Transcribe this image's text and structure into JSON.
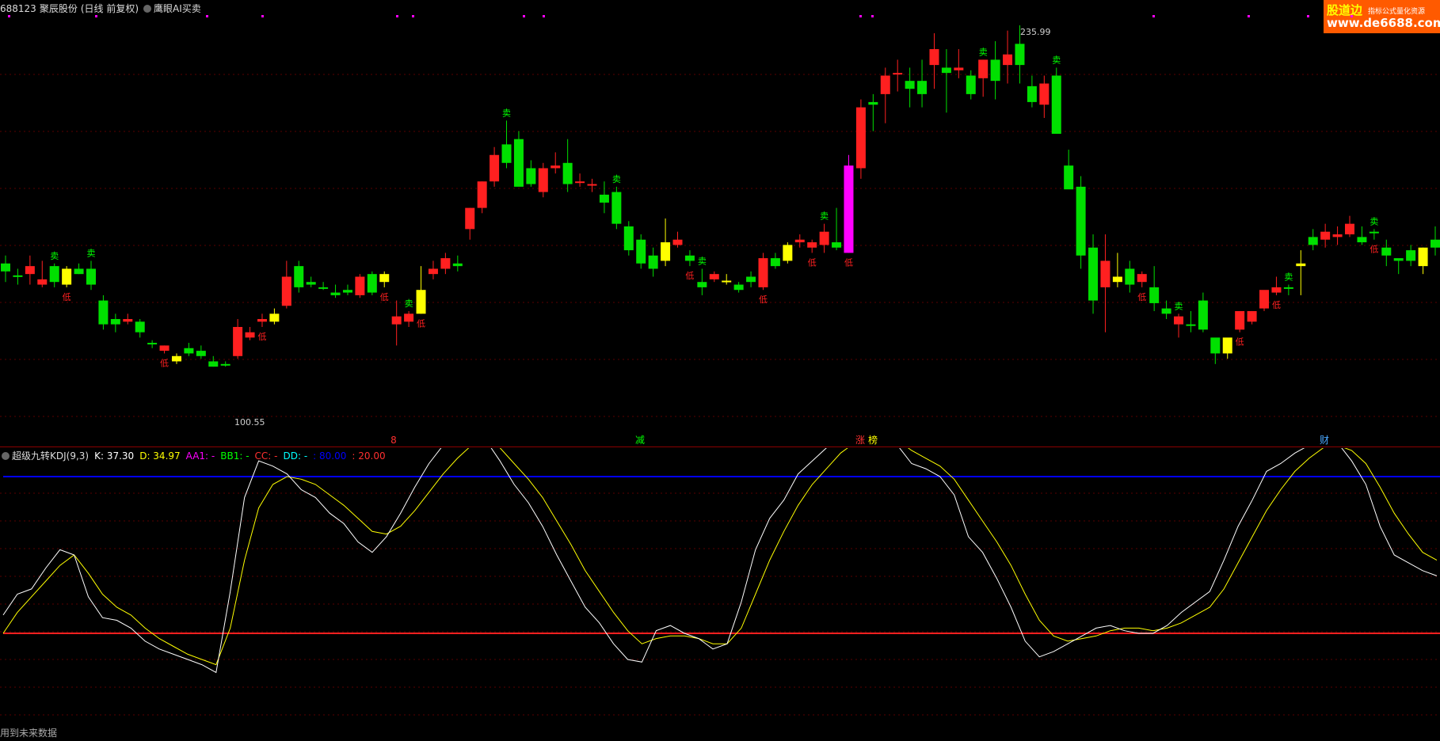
{
  "header": {
    "code": "688123",
    "name": "聚辰股份",
    "period": "(日线 前复权)",
    "indicator": "鹰眼AI买卖"
  },
  "watermark": {
    "brand": "股道边",
    "tagline": "指标公式量化资源",
    "url": "www.de6688.com"
  },
  "price_panel": {
    "high_label": "235.99",
    "low_label": "100.55",
    "signal_sell": "卖",
    "signal_buy": "低",
    "bottom_marks": [
      {
        "text": "8",
        "color": "#ff3030"
      },
      {
        "text": "减",
        "color": "#00ff00"
      },
      {
        "text": "涨",
        "color": "#ff3030"
      },
      {
        "text": "榜",
        "color": "#ffff00"
      },
      {
        "text": "财",
        "color": "#4aa8ff"
      }
    ]
  },
  "indicator_panel": {
    "title": "超级九转KDJ(9,3)",
    "k": "K: 37.30",
    "d": "D: 34.97",
    "aa1": "AA1: -",
    "bb1": "BB1: -",
    "cc": "CC: -",
    "dd": "DD: -",
    "v80": ": 80.00",
    "v20": ": 20.00",
    "colors": {
      "k": "#ffffff",
      "d": "#ffff00",
      "aa1": "#ff00ff",
      "bb1": "#00ff00",
      "cc": "#ff3030",
      "dd": "#00ffff",
      "v80": "#0000ff",
      "v20": "#ff3030"
    }
  },
  "footer": {
    "note": "用到未来数据"
  },
  "chart_data": {
    "type": "candlestick",
    "title": "688123 聚辰股份 (日线 前复权)",
    "price_range_visible": [
      100.55,
      235.99
    ],
    "candles": [
      {
        "o": 159,
        "h": 162,
        "l": 152,
        "c": 156,
        "color": "green"
      },
      {
        "o": 154,
        "h": 157,
        "l": 151,
        "c": 154.5,
        "color": "green"
      },
      {
        "o": 155,
        "h": 162,
        "l": 151,
        "c": 158,
        "color": "red"
      },
      {
        "o": 153,
        "h": 160,
        "l": 150,
        "c": 151,
        "color": "red"
      },
      {
        "o": 152,
        "h": 159,
        "l": 150,
        "c": 158,
        "color": "green"
      },
      {
        "o": 151,
        "h": 158,
        "l": 150,
        "c": 157,
        "color": "yellow"
      },
      {
        "o": 157,
        "h": 159,
        "l": 155,
        "c": 155,
        "color": "green"
      },
      {
        "o": 157,
        "h": 160,
        "l": 149,
        "c": 151,
        "color": "green"
      },
      {
        "o": 145,
        "h": 147,
        "l": 134,
        "c": 136,
        "color": "green"
      },
      {
        "o": 138,
        "h": 140,
        "l": 133,
        "c": 136,
        "color": "green"
      },
      {
        "o": 138,
        "h": 140,
        "l": 136,
        "c": 137,
        "color": "red"
      },
      {
        "o": 137,
        "h": 138,
        "l": 131,
        "c": 133,
        "color": "green"
      },
      {
        "o": 129,
        "h": 130,
        "l": 127,
        "c": 129,
        "color": "green"
      },
      {
        "o": 126,
        "h": 128,
        "l": 125,
        "c": 128,
        "color": "red"
      },
      {
        "o": 122,
        "h": 125,
        "l": 121,
        "c": 124,
        "color": "yellow"
      },
      {
        "o": 127,
        "h": 129,
        "l": 124,
        "c": 125,
        "color": "green"
      },
      {
        "o": 126,
        "h": 128,
        "l": 123,
        "c": 124,
        "color": "green"
      },
      {
        "o": 122,
        "h": 124,
        "l": 120,
        "c": 120,
        "color": "green"
      },
      {
        "o": 120.5,
        "h": 122,
        "l": 120,
        "c": 121,
        "color": "green"
      },
      {
        "o": 124,
        "h": 138,
        "l": 123,
        "c": 135,
        "color": "red"
      },
      {
        "o": 131,
        "h": 135,
        "l": 130,
        "c": 133,
        "color": "red"
      },
      {
        "o": 137,
        "h": 140,
        "l": 135,
        "c": 138,
        "color": "red"
      },
      {
        "o": 137,
        "h": 142,
        "l": 136,
        "c": 140,
        "color": "yellow"
      },
      {
        "o": 143,
        "h": 160,
        "l": 142,
        "c": 154,
        "color": "red"
      },
      {
        "o": 158,
        "h": 160,
        "l": 148,
        "c": 150,
        "color": "green"
      },
      {
        "o": 151,
        "h": 154,
        "l": 150,
        "c": 152,
        "color": "green"
      },
      {
        "o": 150,
        "h": 152,
        "l": 149,
        "c": 150,
        "color": "green"
      },
      {
        "o": 147,
        "h": 151,
        "l": 146,
        "c": 148,
        "color": "green"
      },
      {
        "o": 149,
        "h": 151,
        "l": 147,
        "c": 148,
        "color": "green"
      },
      {
        "o": 147,
        "h": 155,
        "l": 146,
        "c": 154,
        "color": "red"
      },
      {
        "o": 148,
        "h": 156,
        "l": 147,
        "c": 155,
        "color": "green"
      },
      {
        "o": 152,
        "h": 156,
        "l": 150,
        "c": 155,
        "color": "yellow"
      },
      {
        "o": 136,
        "h": 145,
        "l": 128,
        "c": 139,
        "color": "red"
      },
      {
        "o": 137,
        "h": 141,
        "l": 135,
        "c": 140,
        "color": "red"
      },
      {
        "o": 140,
        "h": 158,
        "l": 140,
        "c": 149,
        "color": "yellow"
      },
      {
        "o": 155,
        "h": 160,
        "l": 153,
        "c": 157,
        "color": "red"
      },
      {
        "o": 157,
        "h": 163,
        "l": 155,
        "c": 161,
        "color": "red"
      },
      {
        "o": 158,
        "h": 162,
        "l": 156,
        "c": 159,
        "color": "green"
      },
      {
        "o": 172,
        "h": 180,
        "l": 168,
        "c": 180,
        "color": "red"
      },
      {
        "o": 180,
        "h": 190,
        "l": 178,
        "c": 190,
        "color": "red"
      },
      {
        "o": 190,
        "h": 203,
        "l": 188,
        "c": 200,
        "color": "red"
      },
      {
        "o": 204,
        "h": 213,
        "l": 195,
        "c": 197,
        "color": "green"
      },
      {
        "o": 206,
        "h": 209,
        "l": 190,
        "c": 188,
        "color": "green"
      },
      {
        "o": 195,
        "h": 198,
        "l": 188,
        "c": 189,
        "color": "green"
      },
      {
        "o": 186,
        "h": 197,
        "l": 184,
        "c": 195,
        "color": "red"
      },
      {
        "o": 196,
        "h": 201,
        "l": 193,
        "c": 195,
        "color": "red"
      },
      {
        "o": 197,
        "h": 206,
        "l": 186,
        "c": 189,
        "color": "green"
      },
      {
        "o": 190,
        "h": 193,
        "l": 188,
        "c": 190,
        "color": "red"
      },
      {
        "o": 189,
        "h": 191,
        "l": 186,
        "c": 189,
        "color": "red"
      },
      {
        "o": 185,
        "h": 190,
        "l": 178,
        "c": 182,
        "color": "green"
      },
      {
        "o": 186,
        "h": 188,
        "l": 172,
        "c": 174,
        "color": "green"
      },
      {
        "o": 173,
        "h": 175,
        "l": 162,
        "c": 164,
        "color": "green"
      },
      {
        "o": 168,
        "h": 170,
        "l": 157,
        "c": 159,
        "color": "green"
      },
      {
        "o": 162,
        "h": 165,
        "l": 154,
        "c": 157,
        "color": "green"
      },
      {
        "o": 160,
        "h": 176,
        "l": 158,
        "c": 167,
        "color": "yellow"
      },
      {
        "o": 168,
        "h": 171,
        "l": 165,
        "c": 166,
        "color": "red"
      },
      {
        "o": 162,
        "h": 164,
        "l": 158,
        "c": 160,
        "color": "green"
      },
      {
        "o": 150,
        "h": 157,
        "l": 147,
        "c": 152,
        "color": "green"
      },
      {
        "o": 153,
        "h": 156,
        "l": 152,
        "c": 155,
        "color": "red"
      },
      {
        "o": 152,
        "h": 155,
        "l": 151,
        "c": 152.5,
        "color": "yellow"
      },
      {
        "o": 149,
        "h": 152,
        "l": 148,
        "c": 151,
        "color": "green"
      },
      {
        "o": 154,
        "h": 156,
        "l": 150,
        "c": 152,
        "color": "green"
      },
      {
        "o": 150,
        "h": 163,
        "l": 149,
        "c": 161,
        "color": "red"
      },
      {
        "o": 158,
        "h": 163,
        "l": 157,
        "c": 161,
        "color": "green"
      },
      {
        "o": 166,
        "h": 167,
        "l": 159,
        "c": 160,
        "color": "yellow"
      },
      {
        "o": 167,
        "h": 170,
        "l": 165,
        "c": 168,
        "color": "red"
      },
      {
        "o": 165,
        "h": 168,
        "l": 163,
        "c": 167,
        "color": "red"
      },
      {
        "o": 166,
        "h": 174,
        "l": 163,
        "c": 171,
        "color": "red"
      },
      {
        "o": 165,
        "h": 180,
        "l": 164,
        "c": 167,
        "color": "green"
      },
      {
        "o": 163,
        "h": 200,
        "l": 163,
        "c": 196,
        "color": "magenta"
      },
      {
        "o": 195,
        "h": 221,
        "l": 191,
        "c": 218,
        "color": "red"
      },
      {
        "o": 219,
        "h": 223,
        "l": 209,
        "c": 220,
        "color": "green"
      },
      {
        "o": 223,
        "h": 233,
        "l": 212,
        "c": 230,
        "color": "red"
      },
      {
        "o": 231,
        "h": 236,
        "l": 224,
        "c": 231,
        "color": "red"
      },
      {
        "o": 228,
        "h": 233,
        "l": 218,
        "c": 225,
        "color": "green"
      },
      {
        "o": 228,
        "h": 236,
        "l": 218,
        "c": 223,
        "color": "green"
      },
      {
        "o": 240,
        "h": 246,
        "l": 225,
        "c": 234,
        "color": "red"
      },
      {
        "o": 233,
        "h": 240,
        "l": 216,
        "c": 231,
        "color": "green"
      },
      {
        "o": 232,
        "h": 240,
        "l": 229,
        "c": 233,
        "color": "red"
      },
      {
        "o": 223,
        "h": 232,
        "l": 221,
        "c": 230,
        "color": "green"
      },
      {
        "o": 229,
        "h": 236,
        "l": 222,
        "c": 236,
        "color": "red"
      },
      {
        "o": 236,
        "h": 243,
        "l": 221,
        "c": 228,
        "color": "green"
      },
      {
        "o": 234,
        "h": 247,
        "l": 227,
        "c": 238,
        "color": "red"
      },
      {
        "o": 242,
        "h": 249,
        "l": 227,
        "c": 234,
        "color": "green"
      },
      {
        "o": 226,
        "h": 230,
        "l": 218,
        "c": 220,
        "color": "green"
      },
      {
        "o": 219,
        "h": 230,
        "l": 214,
        "c": 227,
        "color": "red"
      },
      {
        "o": 230,
        "h": 233,
        "l": 208,
        "c": 208,
        "color": "green"
      },
      {
        "o": 196,
        "h": 202,
        "l": 188,
        "c": 187,
        "color": "green"
      },
      {
        "o": 188,
        "h": 192,
        "l": 157,
        "c": 162,
        "color": "green"
      },
      {
        "o": 165,
        "h": 170,
        "l": 140,
        "c": 145,
        "color": "green"
      },
      {
        "o": 160,
        "h": 170,
        "l": 133,
        "c": 150,
        "color": "red"
      },
      {
        "o": 152,
        "h": 163,
        "l": 150,
        "c": 154,
        "color": "yellow"
      },
      {
        "o": 157,
        "h": 160,
        "l": 148,
        "c": 151,
        "color": "green"
      },
      {
        "o": 152,
        "h": 156,
        "l": 150,
        "c": 155,
        "color": "red"
      },
      {
        "o": 150,
        "h": 158,
        "l": 141,
        "c": 144,
        "color": "green"
      },
      {
        "o": 142,
        "h": 145,
        "l": 138,
        "c": 140,
        "color": "green"
      },
      {
        "o": 136,
        "h": 140,
        "l": 131,
        "c": 139,
        "color": "red"
      },
      {
        "o": 136,
        "h": 141,
        "l": 133,
        "c": 136,
        "color": "green"
      },
      {
        "o": 134,
        "h": 148,
        "l": 133,
        "c": 145,
        "color": "green"
      },
      {
        "o": 125,
        "h": 130,
        "l": 121,
        "c": 131,
        "color": "green"
      },
      {
        "o": 125,
        "h": 129,
        "l": 123,
        "c": 131,
        "color": "yellow"
      },
      {
        "o": 134,
        "h": 141,
        "l": 133,
        "c": 141,
        "color": "red"
      },
      {
        "o": 137,
        "h": 141,
        "l": 136,
        "c": 141,
        "color": "red"
      },
      {
        "o": 142,
        "h": 148,
        "l": 141,
        "c": 149,
        "color": "red"
      },
      {
        "o": 148,
        "h": 154,
        "l": 147,
        "c": 150,
        "color": "red"
      },
      {
        "o": 150,
        "h": 151,
        "l": 147,
        "c": 150,
        "color": "green"
      },
      {
        "o": 158,
        "h": 164,
        "l": 147,
        "c": 159,
        "color": "yellow"
      },
      {
        "o": 166,
        "h": 172,
        "l": 164,
        "c": 169,
        "color": "green"
      },
      {
        "o": 171,
        "h": 174,
        "l": 165,
        "c": 168,
        "color": "red"
      },
      {
        "o": 169,
        "h": 173,
        "l": 166,
        "c": 170,
        "color": "red"
      },
      {
        "o": 170,
        "h": 177,
        "l": 169,
        "c": 174,
        "color": "red"
      },
      {
        "o": 169,
        "h": 173,
        "l": 166,
        "c": 167,
        "color": "green"
      },
      {
        "o": 171,
        "h": 172,
        "l": 168,
        "c": 171,
        "color": "green"
      },
      {
        "o": 165,
        "h": 168,
        "l": 158,
        "c": 162,
        "color": "green"
      },
      {
        "o": 160,
        "h": 160,
        "l": 155,
        "c": 161,
        "color": "green"
      },
      {
        "o": 160,
        "h": 166,
        "l": 158,
        "c": 164,
        "color": "green"
      },
      {
        "o": 158,
        "h": 165,
        "l": 155,
        "c": 165,
        "color": "yellow"
      },
      {
        "o": 165,
        "h": 173,
        "l": 162,
        "c": 168,
        "color": "green"
      }
    ],
    "sell_signals_at": [
      4,
      7,
      33,
      41,
      50,
      57,
      67,
      80,
      86,
      96,
      105,
      112
    ],
    "buy_signals_at": [
      5,
      13,
      21,
      31,
      34,
      56,
      62,
      66,
      69,
      93,
      101,
      104,
      112
    ],
    "kdj": {
      "ref_lines": [
        80,
        20
      ],
      "k": [
        27,
        35,
        37,
        45,
        52,
        50,
        34,
        26,
        25,
        22,
        17,
        14,
        12,
        10,
        8,
        5,
        36,
        72,
        86,
        84,
        81,
        75,
        72,
        66,
        62,
        55,
        51,
        57,
        66,
        76,
        85,
        92,
        95,
        97,
        94,
        86,
        77,
        70,
        61,
        50,
        40,
        30,
        24,
        16,
        10,
        9,
        21,
        23,
        20,
        18,
        14,
        16,
        32,
        52,
        64,
        71,
        81,
        86,
        91,
        96,
        98,
        99,
        95,
        92,
        85,
        83,
        80,
        73,
        57,
        51,
        41,
        30,
        17,
        11,
        13,
        16,
        19,
        22,
        23,
        21,
        20,
        20,
        23,
        28,
        32,
        36,
        48,
        61,
        71,
        82,
        85,
        89,
        92,
        95,
        93,
        86,
        77,
        61,
        50,
        47,
        44,
        42
      ],
      "d": [
        20,
        28,
        34,
        40,
        46,
        50,
        43,
        35,
        30,
        27,
        22,
        18,
        15,
        12,
        10,
        8,
        22,
        48,
        68,
        77,
        80,
        79,
        77,
        73,
        69,
        64,
        59,
        58,
        61,
        67,
        74,
        81,
        87,
        92,
        94,
        91,
        85,
        79,
        72,
        63,
        54,
        44,
        36,
        28,
        21,
        16,
        18,
        19,
        19,
        18,
        16,
        16,
        22,
        35,
        48,
        59,
        69,
        77,
        83,
        89,
        93,
        95,
        95,
        94,
        90,
        87,
        84,
        79,
        71,
        63,
        55,
        46,
        35,
        25,
        19,
        17,
        18,
        19,
        21,
        22,
        22,
        21,
        22,
        24,
        27,
        30,
        37,
        47,
        57,
        67,
        75,
        82,
        87,
        91,
        92,
        90,
        85,
        76,
        66,
        58,
        51,
        48
      ]
    }
  }
}
